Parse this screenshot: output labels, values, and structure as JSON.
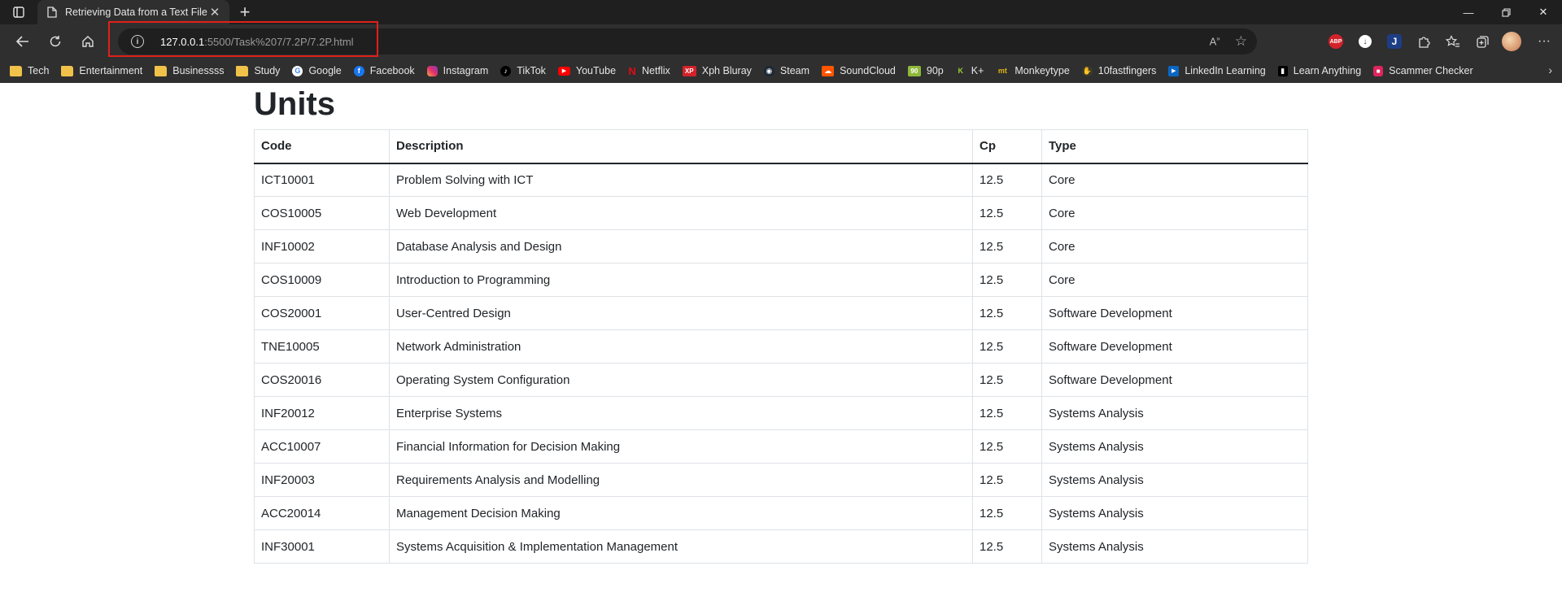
{
  "browser": {
    "tab": {
      "title": "Retrieving Data from a Text File"
    },
    "address": {
      "host": "127.0.0.1",
      "path": ":5500/Task%207/7.2P/7.2P.html"
    },
    "bookmarks": [
      {
        "label": "Tech",
        "icon": "folder-icon"
      },
      {
        "label": "Entertainment",
        "icon": "folder-icon"
      },
      {
        "label": "Businessss",
        "icon": "folder-icon"
      },
      {
        "label": "Study",
        "icon": "folder-icon"
      },
      {
        "label": "Google",
        "icon": "google-icon"
      },
      {
        "label": "Facebook",
        "icon": "facebook-icon"
      },
      {
        "label": "Instagram",
        "icon": "instagram-icon"
      },
      {
        "label": "TikTok",
        "icon": "tiktok-icon"
      },
      {
        "label": "YouTube",
        "icon": "youtube-icon"
      },
      {
        "label": "Netflix",
        "icon": "netflix-icon"
      },
      {
        "label": "Xph Bluray",
        "icon": "xph-icon"
      },
      {
        "label": "Steam",
        "icon": "steam-icon"
      },
      {
        "label": "SoundCloud",
        "icon": "soundcloud-icon"
      },
      {
        "label": "90p",
        "icon": "90p-icon"
      },
      {
        "label": "K+",
        "icon": "kplus-icon"
      },
      {
        "label": "Monkeytype",
        "icon": "monkeytype-icon"
      },
      {
        "label": "10fastfingers",
        "icon": "10fastfingers-icon"
      },
      {
        "label": "LinkedIn Learning",
        "icon": "linkedin-icon"
      },
      {
        "label": "Learn Anything",
        "icon": "learn-anything-icon"
      },
      {
        "label": "Scammer Checker",
        "icon": "lock-icon"
      }
    ],
    "colors": {
      "chrome_dark": "#1f1f1f",
      "toolbar": "#2f2f2f",
      "highlight": "#e0201b"
    }
  },
  "page": {
    "title": "Units",
    "table": {
      "headers": [
        "Code",
        "Description",
        "Cp",
        "Type"
      ],
      "rows": [
        [
          "ICT10001",
          "Problem Solving with ICT",
          "12.5",
          "Core"
        ],
        [
          "COS10005",
          "Web Development",
          "12.5",
          "Core"
        ],
        [
          "INF10002",
          "Database Analysis and Design",
          "12.5",
          "Core"
        ],
        [
          "COS10009",
          "Introduction to Programming",
          "12.5",
          "Core"
        ],
        [
          "COS20001",
          "User-Centred Design",
          "12.5",
          "Software Development"
        ],
        [
          "TNE10005",
          "Network Administration",
          "12.5",
          "Software Development"
        ],
        [
          "COS20016",
          "Operating System Configuration",
          "12.5",
          "Software Development"
        ],
        [
          "INF20012",
          "Enterprise Systems",
          "12.5",
          "Systems Analysis"
        ],
        [
          "ACC10007",
          "Financial Information for Decision Making",
          "12.5",
          "Systems Analysis"
        ],
        [
          "INF20003",
          "Requirements Analysis and Modelling",
          "12.5",
          "Systems Analysis"
        ],
        [
          "ACC20014",
          "Management Decision Making",
          "12.5",
          "Systems Analysis"
        ],
        [
          "INF30001",
          "Systems Acquisition & Implementation Management",
          "12.5",
          "Systems Analysis"
        ]
      ]
    }
  }
}
